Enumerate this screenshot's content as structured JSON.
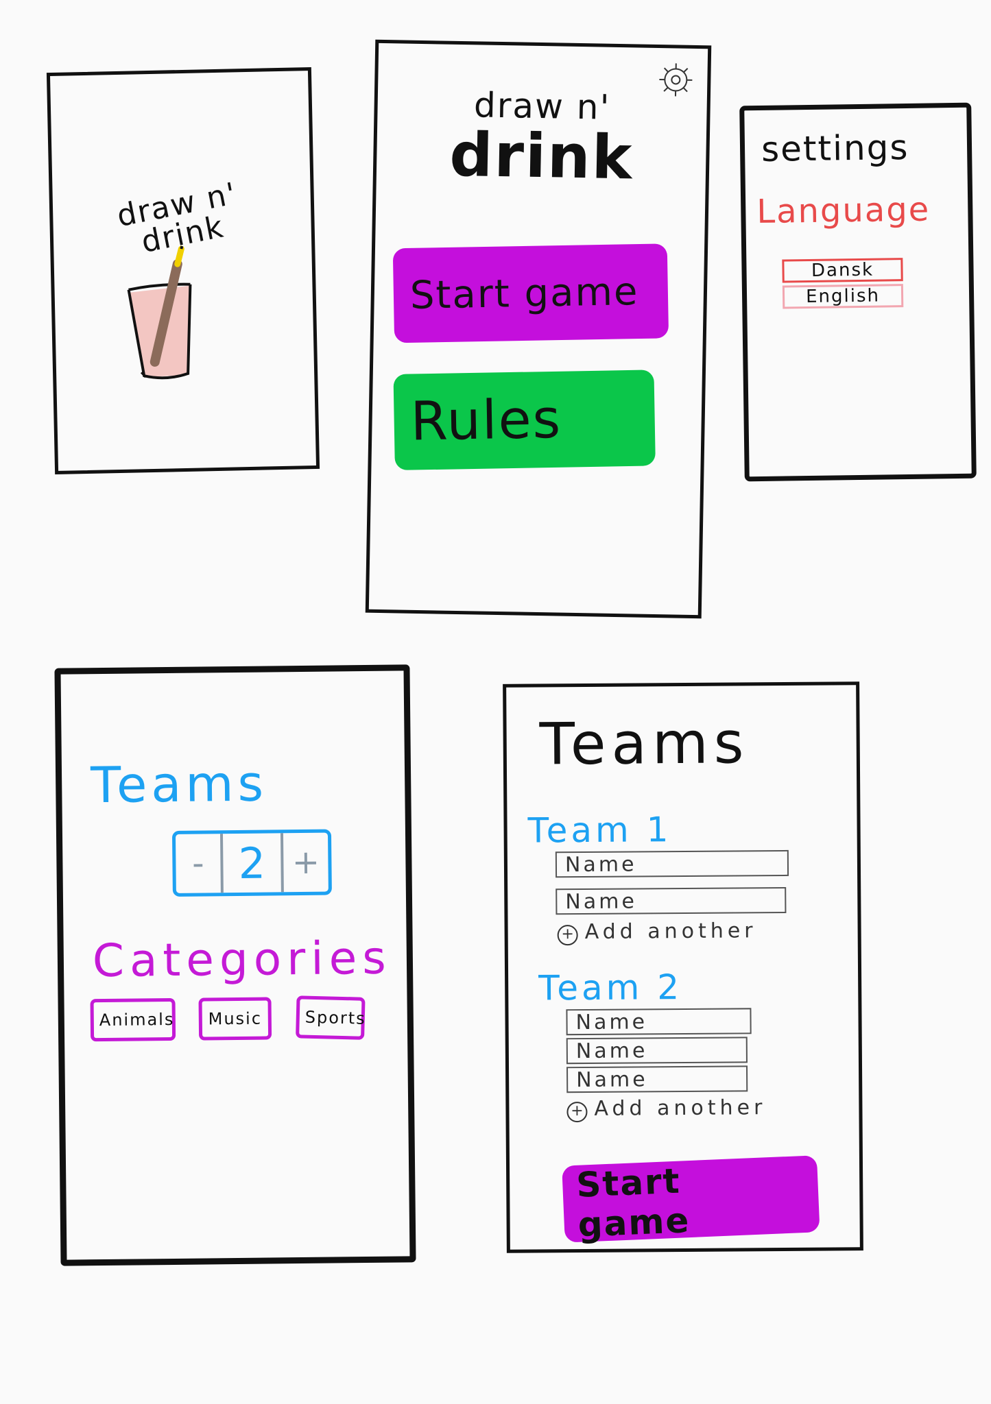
{
  "colors": {
    "purple_button": "#c40fdc",
    "green_button": "#0bc64a",
    "teams_blue": "#1da1f2",
    "categories_magenta": "#c41ad6",
    "language_red": "#e84a4a",
    "language_pink": "#f2a6b0",
    "glass_fill": "#f3c6c2",
    "pencil_brown": "#8b6b5a",
    "pencil_tip": "#f0d000"
  },
  "splash": {
    "title": "draw n' drink",
    "icon": "glass-with-pencil-icon"
  },
  "main": {
    "settings_icon": "gear-icon",
    "title_line1": "draw n'",
    "title_line2": "drink",
    "start_label": "Start game",
    "rules_label": "Rules"
  },
  "settings": {
    "title": "settings",
    "language_label": "Language",
    "languages": [
      "Dansk",
      "English"
    ]
  },
  "team_setup": {
    "teams_label": "Teams",
    "team_count": "2",
    "decrement_label": "-",
    "increment_label": "+",
    "categories_label": "Categories",
    "categories": [
      "Animals",
      "Music",
      "Sports"
    ]
  },
  "team_names": {
    "title": "Teams",
    "teams": [
      {
        "label": "Team 1",
        "name_placeholder": "Name",
        "add_label": "Add another"
      },
      {
        "label": "Team 2",
        "name_placeholder": "Name",
        "add_label": "Add another"
      }
    ],
    "add_icon": "plus-circle-icon",
    "start_label": "Start game"
  }
}
